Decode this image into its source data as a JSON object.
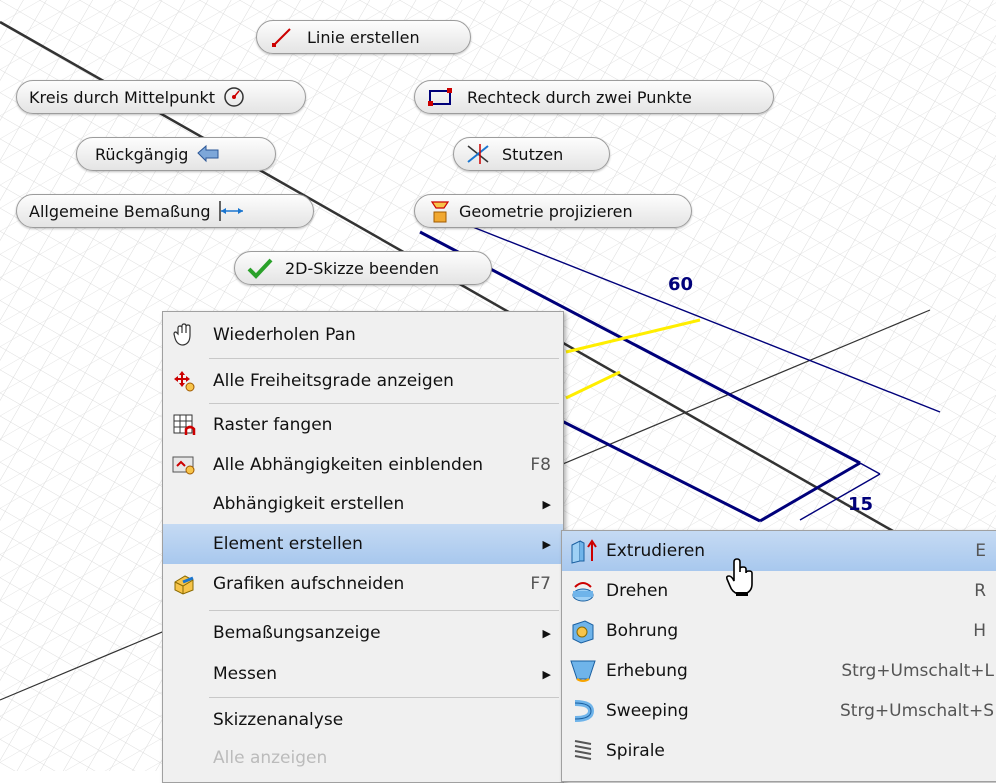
{
  "marking_menu": {
    "line": "Linie erstellen",
    "circle": "Kreis durch Mittelpunkt",
    "rectangle": "Rechteck durch zwei Punkte",
    "undo": "Rückgängig",
    "trim": "Stutzen",
    "dimension": "Allgemeine Bemaßung",
    "project": "Geometrie projizieren",
    "finish": "2D-Skizze beenden"
  },
  "dimensions": {
    "length": "60",
    "width": "15"
  },
  "context_menu": {
    "items": [
      {
        "label": "Wiederholen Pan",
        "icon": "pan-hand-icon"
      },
      {
        "label": "Alle Freiheitsgrade anzeigen",
        "icon": "dof-icon"
      },
      {
        "label": "Raster fangen",
        "icon": "grid-snap-icon"
      },
      {
        "label": "Alle Abhängigkeiten einblenden",
        "shortcut": "F8",
        "icon": "constraints-icon"
      },
      {
        "label": "Abhängigkeit erstellen",
        "submenu": true
      },
      {
        "label": "Element erstellen",
        "submenu": true,
        "highlighted": true
      },
      {
        "label": "Grafiken aufschneiden",
        "shortcut": "F7",
        "icon": "slice-graphics-icon"
      },
      {
        "label": "Bemaßungsanzeige",
        "submenu": true
      },
      {
        "label": "Messen",
        "submenu": true
      },
      {
        "label": "Skizzenanalyse"
      },
      {
        "label": "Alle anzeigen"
      }
    ]
  },
  "submenu": {
    "items": [
      {
        "label": "Extrudieren",
        "shortcut": "E",
        "icon": "extrude-icon",
        "highlighted": true
      },
      {
        "label": "Drehen",
        "shortcut": "R",
        "icon": "revolve-icon"
      },
      {
        "label": "Bohrung",
        "shortcut": "H",
        "icon": "hole-icon"
      },
      {
        "label": "Erhebung",
        "shortcut": "Strg+Umschalt+L",
        "icon": "loft-icon"
      },
      {
        "label": "Sweeping",
        "shortcut": "Strg+Umschalt+S",
        "icon": "sweep-icon"
      },
      {
        "label": "Spirale",
        "icon": "coil-icon"
      }
    ]
  },
  "colors": {
    "sketch_line": "#00007a",
    "highlight_line": "#ffee00",
    "menu_highlight": "#b5cff0"
  }
}
